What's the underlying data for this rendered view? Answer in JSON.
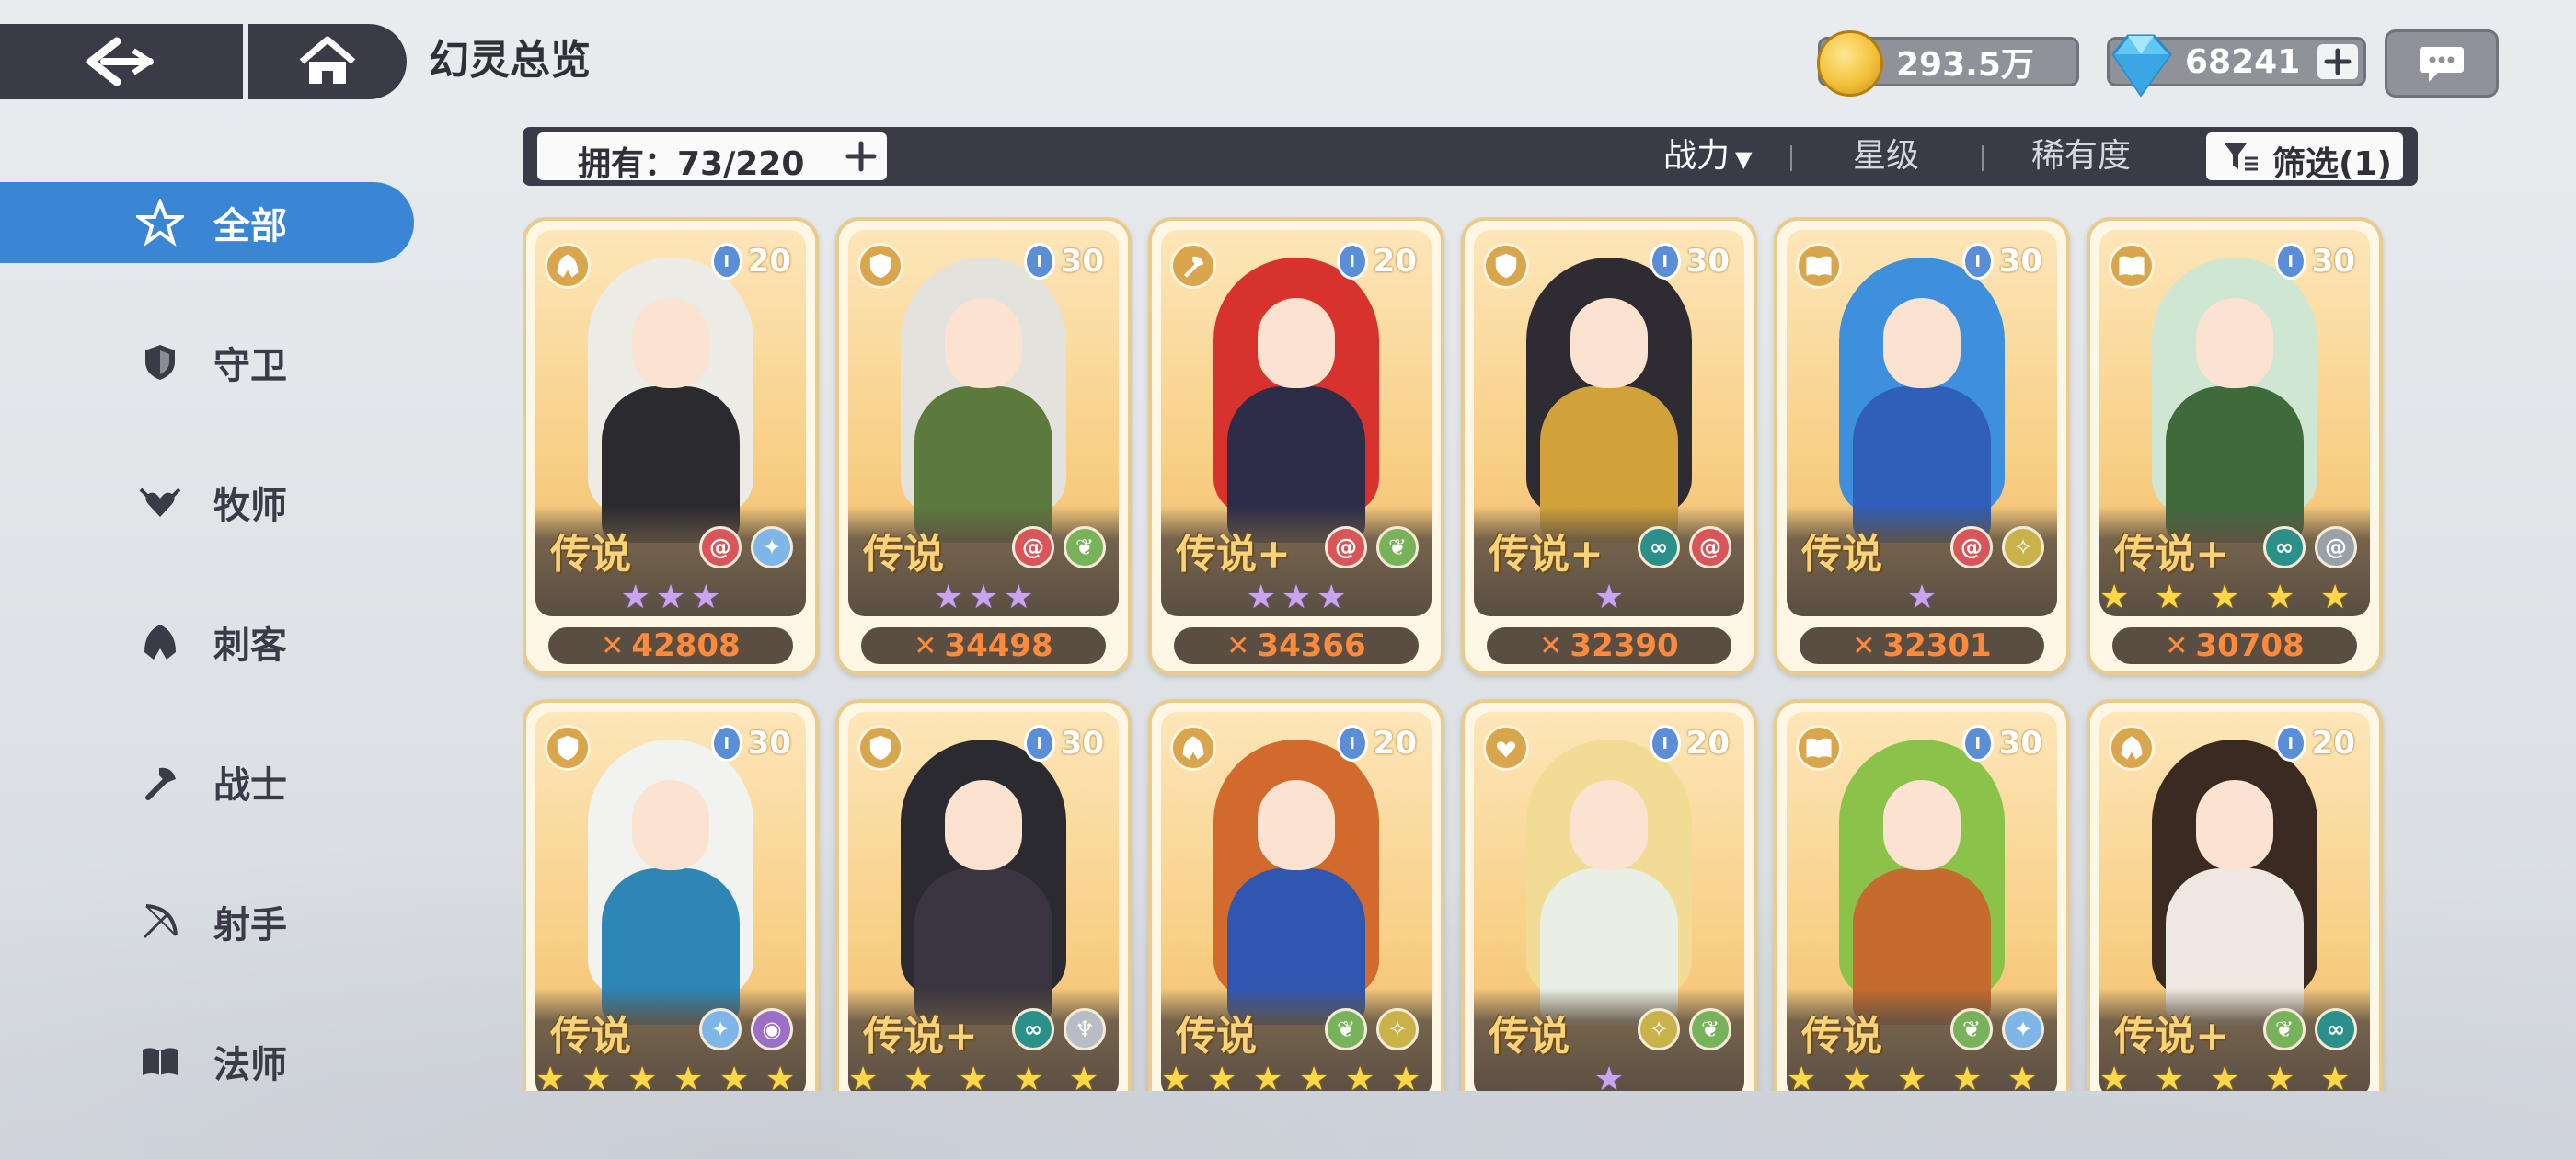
{
  "header": {
    "title": "幻灵总览",
    "gold": "293.5万",
    "gems": "68241"
  },
  "sidebar": {
    "items": [
      {
        "label": "全部",
        "icon": "star-outline-icon",
        "active": true
      },
      {
        "label": "守卫",
        "icon": "shield-icon",
        "active": false
      },
      {
        "label": "牧师",
        "icon": "wing-heart-icon",
        "active": false
      },
      {
        "label": "刺客",
        "icon": "hood-icon",
        "active": false
      },
      {
        "label": "战士",
        "icon": "axe-icon",
        "active": false
      },
      {
        "label": "射手",
        "icon": "bow-icon",
        "active": false
      },
      {
        "label": "法师",
        "icon": "book-icon",
        "active": false
      }
    ]
  },
  "filter": {
    "owned": "拥有：73/220",
    "sort_power": "战力",
    "sort_star": "星级",
    "sort_rarity": "稀有度",
    "filter_label": "筛选(1)"
  },
  "cards": [
    {
      "class": "assassin",
      "level": "20",
      "rarity": "传说",
      "elements": [
        "swirl",
        "ice"
      ],
      "star_count": 3,
      "star_color": "purple",
      "power": "42808",
      "hair": "#ecebe6",
      "outfit": "#2b2a2e"
    },
    {
      "class": "guard",
      "level": "30",
      "rarity": "传说",
      "elements": [
        "swirl",
        "leaf"
      ],
      "star_count": 3,
      "star_color": "purple",
      "power": "34498",
      "hair": "#e3e2dc",
      "outfit": "#5c7a3e"
    },
    {
      "class": "warrior",
      "level": "20",
      "rarity": "传说+",
      "elements": [
        "swirl",
        "leaf"
      ],
      "star_count": 3,
      "star_color": "purple",
      "power": "34366",
      "hair": "#d8322e",
      "outfit": "#2e2d48"
    },
    {
      "class": "guard",
      "level": "30",
      "rarity": "传说+",
      "elements": [
        "void",
        "swirl"
      ],
      "star_count": 1,
      "star_color": "purple",
      "power": "32390",
      "hair": "#2e2b33",
      "outfit": "#d2a23a"
    },
    {
      "class": "mage",
      "level": "30",
      "rarity": "传说",
      "elements": [
        "swirl",
        "light"
      ],
      "star_count": 1,
      "star_color": "purple",
      "power": "32301",
      "hair": "#3e8fdc",
      "outfit": "#2f5fb8"
    },
    {
      "class": "mage",
      "level": "30",
      "rarity": "传说+",
      "elements": [
        "void",
        "wind"
      ],
      "star_count": 5,
      "star_color": "gold",
      "power": "30708",
      "hair": "#cfe6d3",
      "outfit": "#3f6b3c"
    },
    {
      "class": "guard",
      "level": "30",
      "rarity": "传说",
      "elements": [
        "ice",
        "arcane"
      ],
      "star_count": 6,
      "star_color": "gold",
      "power": "",
      "hair": "#f2f2f0",
      "outfit": "#2e86b6"
    },
    {
      "class": "guard",
      "level": "30",
      "rarity": "传说+",
      "elements": [
        "void",
        "wing"
      ],
      "star_count": 5,
      "star_color": "gold",
      "power": "",
      "hair": "#2a2a30",
      "outfit": "#3a3540"
    },
    {
      "class": "assassin",
      "level": "20",
      "rarity": "传说",
      "elements": [
        "leaf",
        "light"
      ],
      "star_count": 6,
      "star_color": "gold",
      "power": "",
      "hair": "#d16a2c",
      "outfit": "#2f56b0"
    },
    {
      "class": "priest",
      "level": "20",
      "rarity": "传说",
      "elements": [
        "light",
        "leaf"
      ],
      "star_count": 1,
      "star_color": "purple",
      "power": "",
      "hair": "#f2dc95",
      "outfit": "#e9efe4"
    },
    {
      "class": "mage",
      "level": "30",
      "rarity": "传说",
      "elements": [
        "leaf",
        "ice"
      ],
      "star_count": 5,
      "star_color": "gold",
      "power": "",
      "hair": "#8bc34a",
      "outfit": "#c56b2e"
    },
    {
      "class": "assassin",
      "level": "20",
      "rarity": "传说+",
      "elements": [
        "leaf",
        "void"
      ],
      "star_count": 5,
      "star_color": "gold",
      "power": "",
      "hair": "#3a2a22",
      "outfit": "#efe8e0"
    }
  ],
  "colors": {
    "accent": "#3b86d4",
    "dark_bar": "#3a3b46",
    "power_text": "#ff8a3c"
  }
}
